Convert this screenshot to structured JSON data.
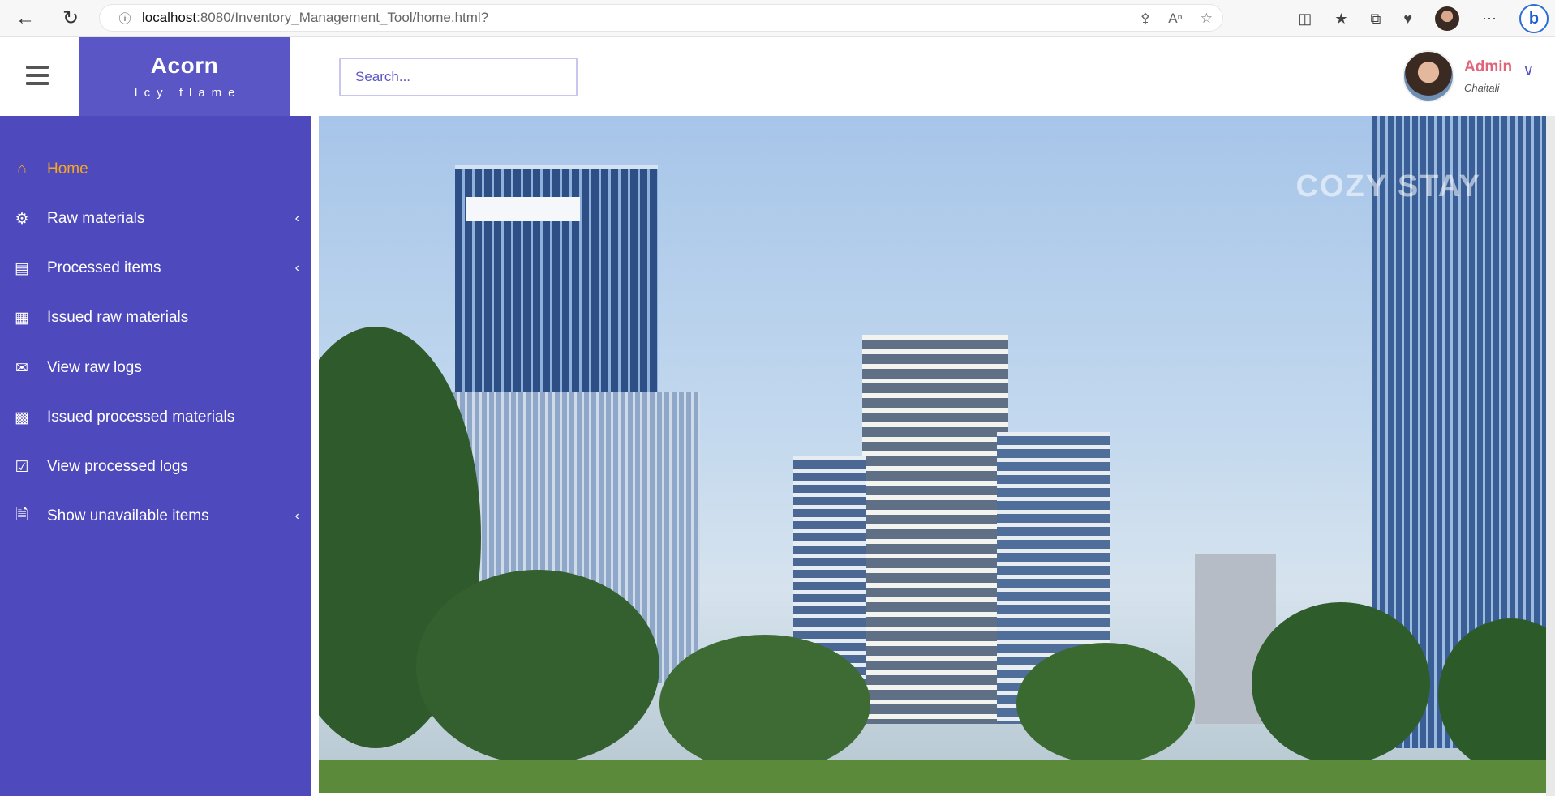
{
  "browser": {
    "url_host": "localhost",
    "url_path": ":8080/Inventory_Management_Tool/home.html?"
  },
  "header": {
    "brand_name": "Acorn",
    "brand_tagline": "Icy flame",
    "search_placeholder": "Search...",
    "user_role": "Admin",
    "user_name": "Chaitali"
  },
  "sidebar": {
    "items": [
      {
        "label": "Home",
        "icon": "home-icon",
        "active": true,
        "has_submenu": false
      },
      {
        "label": "Raw materials",
        "icon": "cogs-icon",
        "active": false,
        "has_submenu": true
      },
      {
        "label": "Processed items",
        "icon": "book-icon",
        "active": false,
        "has_submenu": true
      },
      {
        "label": "Issued raw materials",
        "icon": "th-large-icon",
        "active": false,
        "has_submenu": false
      },
      {
        "label": "View raw logs",
        "icon": "envelope-icon",
        "active": false,
        "has_submenu": false
      },
      {
        "label": "Issued processed materials",
        "icon": "table-icon",
        "active": false,
        "has_submenu": false
      },
      {
        "label": "View processed logs",
        "icon": "check-square-icon",
        "active": false,
        "has_submenu": false
      },
      {
        "label": "Show unavailable items",
        "icon": "file-text-icon",
        "active": false,
        "has_submenu": true
      }
    ]
  },
  "hero": {
    "watermark": "COZY STAY"
  },
  "colors": {
    "sidebar": "#4e49bd",
    "brand": "#5b56c6",
    "active_item": "#f5a623",
    "user_role": "#e0647a"
  }
}
